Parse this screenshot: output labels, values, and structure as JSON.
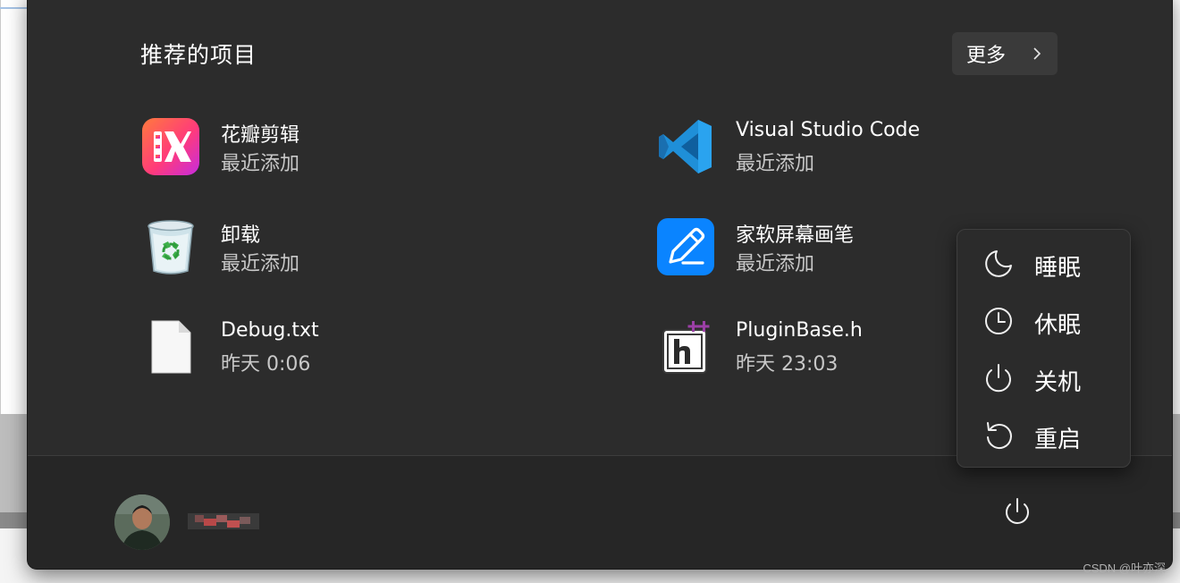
{
  "recommended": {
    "title": "推荐的项目",
    "more_label": "更多"
  },
  "items": [
    {
      "name": "花瓣剪辑",
      "sub": "最近添加",
      "icon": "huaban-jianji-app-icon"
    },
    {
      "name": "Visual Studio Code",
      "sub": "最近添加",
      "icon": "vscode-app-icon"
    },
    {
      "name": "卸载",
      "sub": "最近添加",
      "icon": "recycle-bin-icon"
    },
    {
      "name": "家软屏幕画笔",
      "sub": "最近添加",
      "icon": "screen-pen-app-icon"
    },
    {
      "name": "Debug.txt",
      "sub": "昨天 0:06",
      "icon": "text-file-icon"
    },
    {
      "name": "PluginBase.h",
      "sub": "昨天 23:03",
      "icon": "cpp-header-file-icon"
    }
  ],
  "power_menu": {
    "items": [
      {
        "label": "睡眠",
        "icon": "moon-icon"
      },
      {
        "label": "休眠",
        "icon": "clock-icon"
      },
      {
        "label": "关机",
        "icon": "power-icon"
      },
      {
        "label": "重启",
        "icon": "restart-icon"
      }
    ]
  },
  "footer": {
    "avatar": "user-avatar",
    "power_button": "power-icon"
  },
  "watermark": "CSDN @叶亦深",
  "colors": {
    "menu_bg": "#2c2c2c",
    "footer_bg": "#262626",
    "text": "#ffffff",
    "subtext": "#c8c8c8",
    "vscode_blue": "#1a8ad4",
    "pen_blue": "#0a84ff"
  }
}
